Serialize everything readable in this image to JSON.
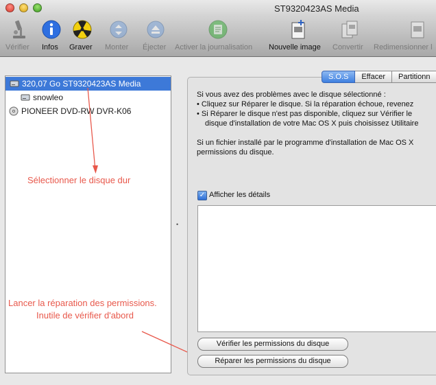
{
  "window": {
    "title": "ST9320423AS Media"
  },
  "toolbar": {
    "items": [
      {
        "label": "Vérifier",
        "icon": "microscope-icon",
        "enabled": false
      },
      {
        "label": "Infos",
        "icon": "info-icon",
        "enabled": true
      },
      {
        "label": "Graver",
        "icon": "burn-icon",
        "enabled": true
      },
      {
        "label": "Monter",
        "icon": "mount-icon",
        "enabled": false
      },
      {
        "label": "Éjecter",
        "icon": "eject-icon",
        "enabled": false
      },
      {
        "label": "Activer la journalisation",
        "icon": "journaling-icon",
        "enabled": false
      },
      {
        "label": "Nouvelle image",
        "icon": "new-image-icon",
        "enabled": true
      },
      {
        "label": "Convertir",
        "icon": "convert-icon",
        "enabled": false
      },
      {
        "label": "Redimensionner l",
        "icon": "resize-image-icon",
        "enabled": false
      }
    ]
  },
  "sidebar": {
    "items": [
      {
        "label": "320,07 Go ST9320423AS Media",
        "icon": "hard-disk-icon",
        "selected": true
      },
      {
        "label": "snowleo",
        "icon": "volume-icon",
        "selected": false
      },
      {
        "label": "PIONEER DVD-RW DVR-K06",
        "icon": "optical-drive-icon",
        "selected": false
      }
    ]
  },
  "annotations": {
    "select_disk": "Sélectionner le disque dur",
    "launch_line1": "Lancer la réparation des permissions.",
    "launch_line2": "Inutile de vérifier d'abord",
    "color": "#e8584b"
  },
  "tabs": [
    {
      "label": "S.O.S",
      "active": true
    },
    {
      "label": "Effacer",
      "active": false
    },
    {
      "label": "Partitionn",
      "active": false
    }
  ],
  "sos": {
    "intro": "Si vous avez des problèmes avec le disque sélectionné :",
    "bullet1": "•  Cliquez sur Réparer le disque. Si la réparation échoue, revenez",
    "bullet2": "•  Si Réparer le disque n'est pas disponible, cliquez sur Vérifier le",
    "bullet2_cont": "disque d'installation de votre Mac OS X puis choisissez Utilitaire",
    "perm_line1": "Si un fichier installé par le programme d'installation de Mac OS X",
    "perm_line2": "permissions du disque.",
    "show_details_label": "Afficher les détails",
    "show_details_checked": true,
    "verify_perms_button": "Vérifier les permissions du disque",
    "repair_perms_button": "Réparer les permissions du disque"
  },
  "colors": {
    "selection": "#3d79d8",
    "accent_tab": "#3e7fe0"
  }
}
